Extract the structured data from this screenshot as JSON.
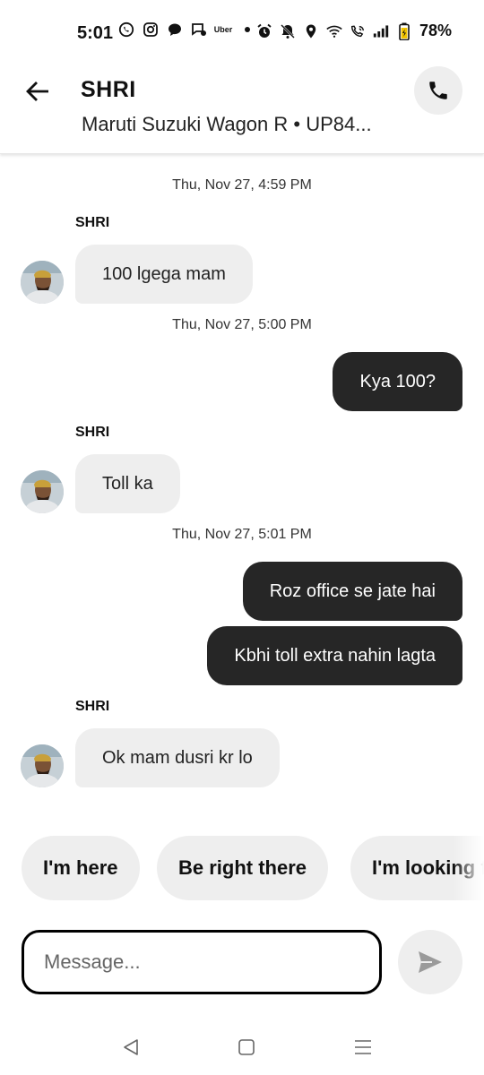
{
  "status_bar": {
    "time": "5:01",
    "uber_label": "Uber",
    "battery": "78%"
  },
  "header": {
    "name": "SHRI",
    "subtitle": "Maruti Suzuki Wagon R • UP84..."
  },
  "messages": [
    {
      "type": "timestamp",
      "text": "Thu, Nov 27, 4:59 PM"
    },
    {
      "type": "incoming",
      "sender": "SHRI",
      "text": "100 lgega mam"
    },
    {
      "type": "timestamp",
      "text": "Thu, Nov 27, 5:00 PM"
    },
    {
      "type": "outgoing",
      "text": "Kya 100?"
    },
    {
      "type": "incoming",
      "sender": "SHRI",
      "text": "Toll ka"
    },
    {
      "type": "timestamp",
      "text": "Thu, Nov 27, 5:01 PM"
    },
    {
      "type": "outgoing",
      "text": "Roz office se jate hai"
    },
    {
      "type": "outgoing",
      "text": "Kbhi toll extra nahin lagta"
    },
    {
      "type": "incoming",
      "sender": "SHRI",
      "text": "Ok mam dusri kr  lo"
    }
  ],
  "quick_replies": [
    "I'm here",
    "Be right there",
    "I'm looking for you"
  ],
  "composer": {
    "placeholder": "Message...",
    "value": ""
  },
  "colors": {
    "outgoing_bubble": "#262626",
    "incoming_bubble": "#eeeeee",
    "chip_bg": "#eeeeee"
  },
  "icons": {
    "back": "arrow-left-icon",
    "call": "phone-icon",
    "send": "send-icon",
    "nav": [
      "back-triangle-icon",
      "home-square-icon",
      "recents-lines-icon"
    ]
  }
}
